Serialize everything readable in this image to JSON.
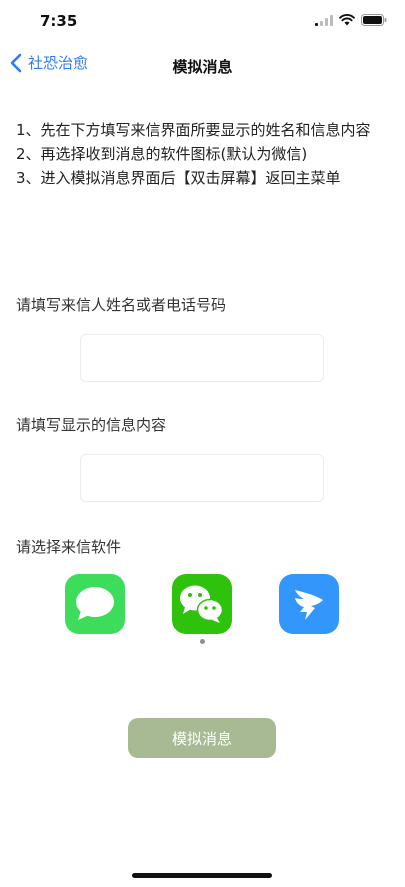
{
  "status_bar": {
    "time": "7:35"
  },
  "nav": {
    "back_label": "社恐治愈",
    "title": "模拟消息"
  },
  "instructions": [
    "1、先在下方填写来信界面所要显示的姓名和信息内容",
    "2、再选择收到消息的软件图标(默认为微信)",
    "3、进入模拟消息界面后【双击屏幕】返回主菜单"
  ],
  "form": {
    "name_label": "请填写来信人姓名或者电话号码",
    "name_value": "",
    "content_label": "请填写显示的信息内容",
    "content_value": "",
    "app_label": "请选择来信软件"
  },
  "apps": [
    {
      "icon": "messages-icon",
      "color": "#3ddc5a",
      "selected": false
    },
    {
      "icon": "wechat-icon",
      "color": "#2ec20c",
      "selected": true
    },
    {
      "icon": "dingtalk-icon",
      "color": "#3296fa",
      "selected": false
    }
  ],
  "submit_label": "模拟消息",
  "colors": {
    "accent": "#2f7cf6",
    "button": "#a8ba94"
  }
}
